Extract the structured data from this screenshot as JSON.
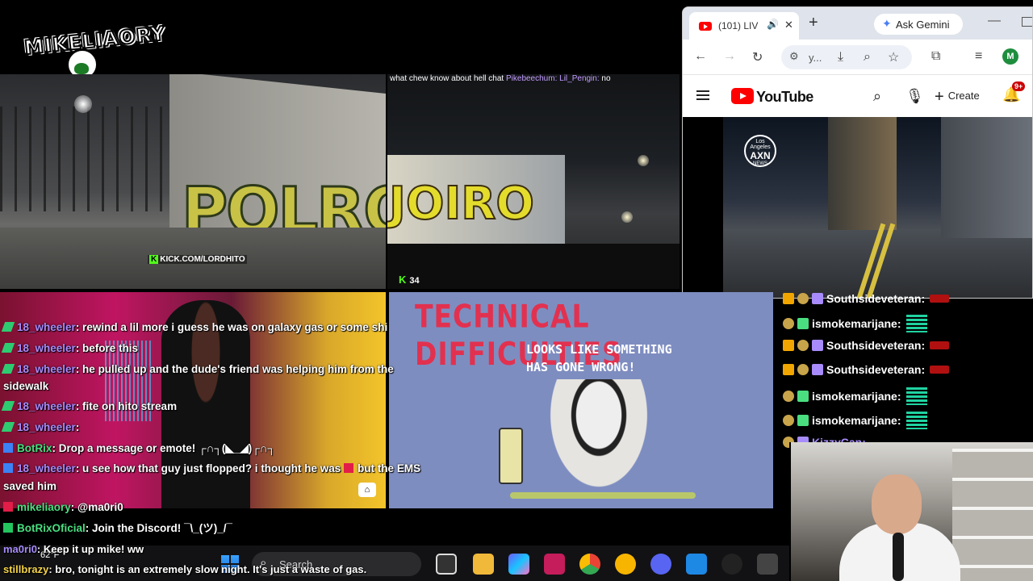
{
  "logo": {
    "text": "MIKELIAORY"
  },
  "cam1": {
    "graffiti": "POLRO",
    "watermark": "KICK.COM/LORDHITO"
  },
  "cam2": {
    "chat": {
      "text1": "what chew know about hell chat",
      "user1": "Pikebeechum:",
      "user2": "Lil_Pengin:",
      "text2": "no"
    },
    "graffiti": "JOIRO",
    "viewer_count": "34"
  },
  "browser": {
    "tab": {
      "title": "(101) LIV",
      "close": "✕"
    },
    "new_tab": "+",
    "gemini": "Ask Gemini",
    "minimize": "—",
    "url": "y...",
    "avatar": "M",
    "youtube": {
      "wordmark": "YouTube",
      "create": "Create",
      "notifications": "9+",
      "channel_badge": {
        "line1": "Los Angeles",
        "line2": "AXN",
        "line3": "NEWS"
      }
    }
  },
  "right_chat": [
    {
      "user": "Southsideveteran:",
      "badges": [
        "crown",
        "gold",
        "purple"
      ],
      "emote": "red"
    },
    {
      "user": "ismokemarijane:",
      "badges": [
        "gold",
        "green"
      ],
      "emote": "teal"
    },
    {
      "user": "Southsideveteran:",
      "badges": [
        "crown",
        "gold",
        "purple"
      ],
      "emote": "red"
    },
    {
      "user": "Southsideveteran:",
      "badges": [
        "crown",
        "gold",
        "purple"
      ],
      "emote": "red"
    },
    {
      "user": "ismokemarijane:",
      "badges": [
        "gold",
        "green"
      ],
      "emote": "teal"
    },
    {
      "user": "ismokemarijane:",
      "badges": [
        "gold",
        "green"
      ],
      "emote": "teal"
    },
    {
      "user": "KizzyCan:",
      "badges": [
        "gold",
        "purple"
      ],
      "emote": "none"
    }
  ],
  "left_chat": [
    {
      "user": "18_wheeler",
      "text": ": rewind a lil more i guess he was on galaxy gas or some shi"
    },
    {
      "user": "18_wheeler",
      "text": ": before this"
    },
    {
      "user": "18_wheeler",
      "text": ": he pulled up and the dude's friend was helping him from the"
    },
    {
      "user": "",
      "text": "sidewalk"
    },
    {
      "user": "18_wheeler",
      "text": ": fite on hito stream"
    },
    {
      "user": "18_wheeler",
      "text": ":"
    },
    {
      "user": "BotRix",
      "text": ": Drop a message or emote! ┌∩┐(◣_◢)┌∩┐"
    },
    {
      "user": "18_wheeler",
      "text": ": u see how that guy just flopped? i thought he was"
    },
    {
      "user": "",
      "text": "but the EMS"
    },
    {
      "user": "",
      "text": "saved him"
    },
    {
      "user": "mikeliaory",
      "text": ": @ma0ri0"
    },
    {
      "user": "BotRixOficial",
      "text": ": Join the Discord! ¯\\_(ツ)_/¯"
    },
    {
      "user": "ma0ri0",
      "text": ": Keep it up mike! ww"
    },
    {
      "user": "stillbrazy",
      "text": ": bro, tonight is an extremely slow night. It's just a waste of gas."
    }
  ],
  "tech": {
    "title": "TECHNICAL DIFFICULTIES",
    "line1": "LOOKS LIKE SOMETHING",
    "line2": "HAS GONE WRONG!"
  },
  "taskbar": {
    "weather": "62°F",
    "search": "Search"
  },
  "colors": {
    "kick_green": "#53fc18",
    "youtube_red": "#ff0000",
    "tech_red": "#e2314f",
    "tech_bg": "#7e8dc0"
  }
}
